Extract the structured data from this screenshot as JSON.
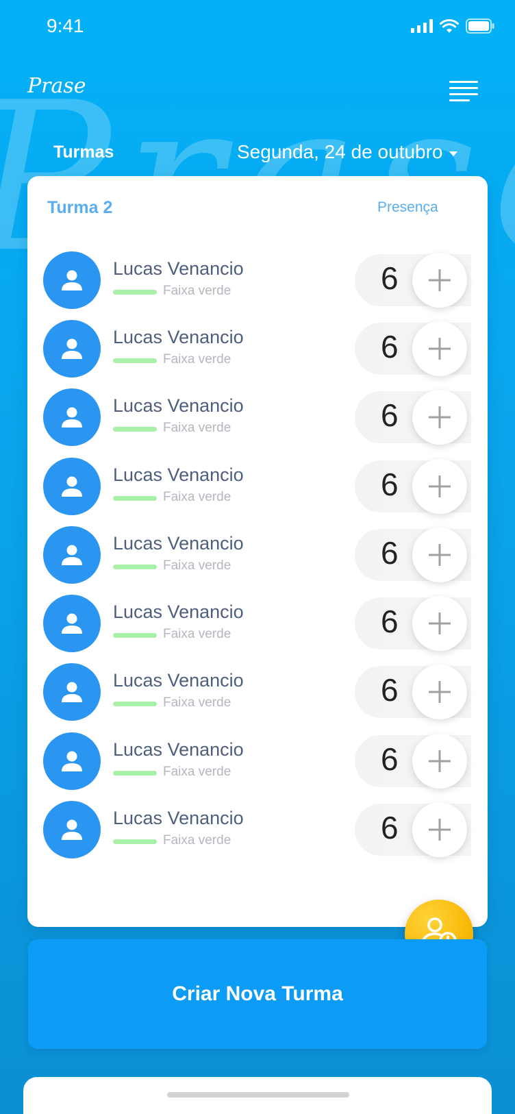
{
  "status_bar": {
    "time": "9:41",
    "icons": [
      "cellular-signal-icon",
      "wifi-icon",
      "battery-icon"
    ]
  },
  "header": {
    "brand": "Prase",
    "menu_icon": "hamburger-menu-icon",
    "tab_title": "Turmas",
    "date": "Segunda, 24 de outubro"
  },
  "card": {
    "title": "Turma 2",
    "column_label": "Presença",
    "students": [
      {
        "name": "Lucas Venancio",
        "belt": "Faixa verde",
        "count": "6"
      },
      {
        "name": "Lucas Venancio",
        "belt": "Faixa verde",
        "count": "6"
      },
      {
        "name": "Lucas Venancio",
        "belt": "Faixa verde",
        "count": "6"
      },
      {
        "name": "Lucas Venancio",
        "belt": "Faixa verde",
        "count": "6"
      },
      {
        "name": "Lucas Venancio",
        "belt": "Faixa verde",
        "count": "6"
      },
      {
        "name": "Lucas Venancio",
        "belt": "Faixa verde",
        "count": "6"
      },
      {
        "name": "Lucas Venancio",
        "belt": "Faixa verde",
        "count": "6"
      },
      {
        "name": "Lucas Venancio",
        "belt": "Faixa verde",
        "count": "6"
      },
      {
        "name": "Lucas Venancio",
        "belt": "Faixa verde",
        "count": "6"
      }
    ]
  },
  "fab_icon": "add-user-icon",
  "create_button": "Criar Nova Turma",
  "colors": {
    "background": "#04b1f7",
    "accent": "#2b96f2",
    "title_blue": "#5aaef0",
    "belt_green": "#a9f0a8",
    "fab_yellow": "#f7b500",
    "button_blue": "#0c9cf5"
  }
}
